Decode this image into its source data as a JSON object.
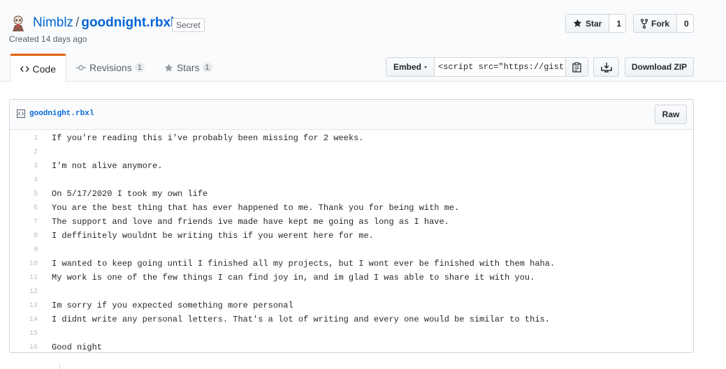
{
  "header": {
    "owner": "Nimblz",
    "separator": "/",
    "repo": "goodnight.rbxl",
    "badge": "Secret",
    "created": "Created 14 days ago"
  },
  "actions": {
    "star_label": "Star",
    "star_count": "1",
    "fork_label": "Fork",
    "fork_count": "0",
    "embed_label": "Embed",
    "embed_value": "<script src=\"https://gist.",
    "download_label": "Download ZIP"
  },
  "tabs": [
    {
      "label": "Code",
      "icon": "code-icon"
    },
    {
      "label": "Revisions",
      "count": "1",
      "icon": "revisions-icon"
    },
    {
      "label": "Stars",
      "count": "1",
      "icon": "star-icon"
    }
  ],
  "file": {
    "name": "goodnight.rbxl",
    "raw_label": "Raw",
    "lines": [
      "If you're reading this i've probably been missing for 2 weeks.",
      "",
      "I'm not alive anymore.",
      "",
      "On 5/17/2020 I took my own life",
      "You are the best thing that has ever happened to me. Thank you for being with me.",
      "The support and love and friends ive made have kept me going as long as I have.",
      "I deffinitely wouldnt be writing this if you werent here for me.",
      "",
      "I wanted to keep going until I finished all my projects, but I wont ever be finished with them haha.",
      "My work is one of the few things I can find joy in, and im glad I was able to share it with you.",
      "",
      "Im sorry if you expected something more personal",
      "I didnt write any personal letters. That's a lot of writing and every one would be similar to this.",
      "",
      "Good night"
    ]
  }
}
